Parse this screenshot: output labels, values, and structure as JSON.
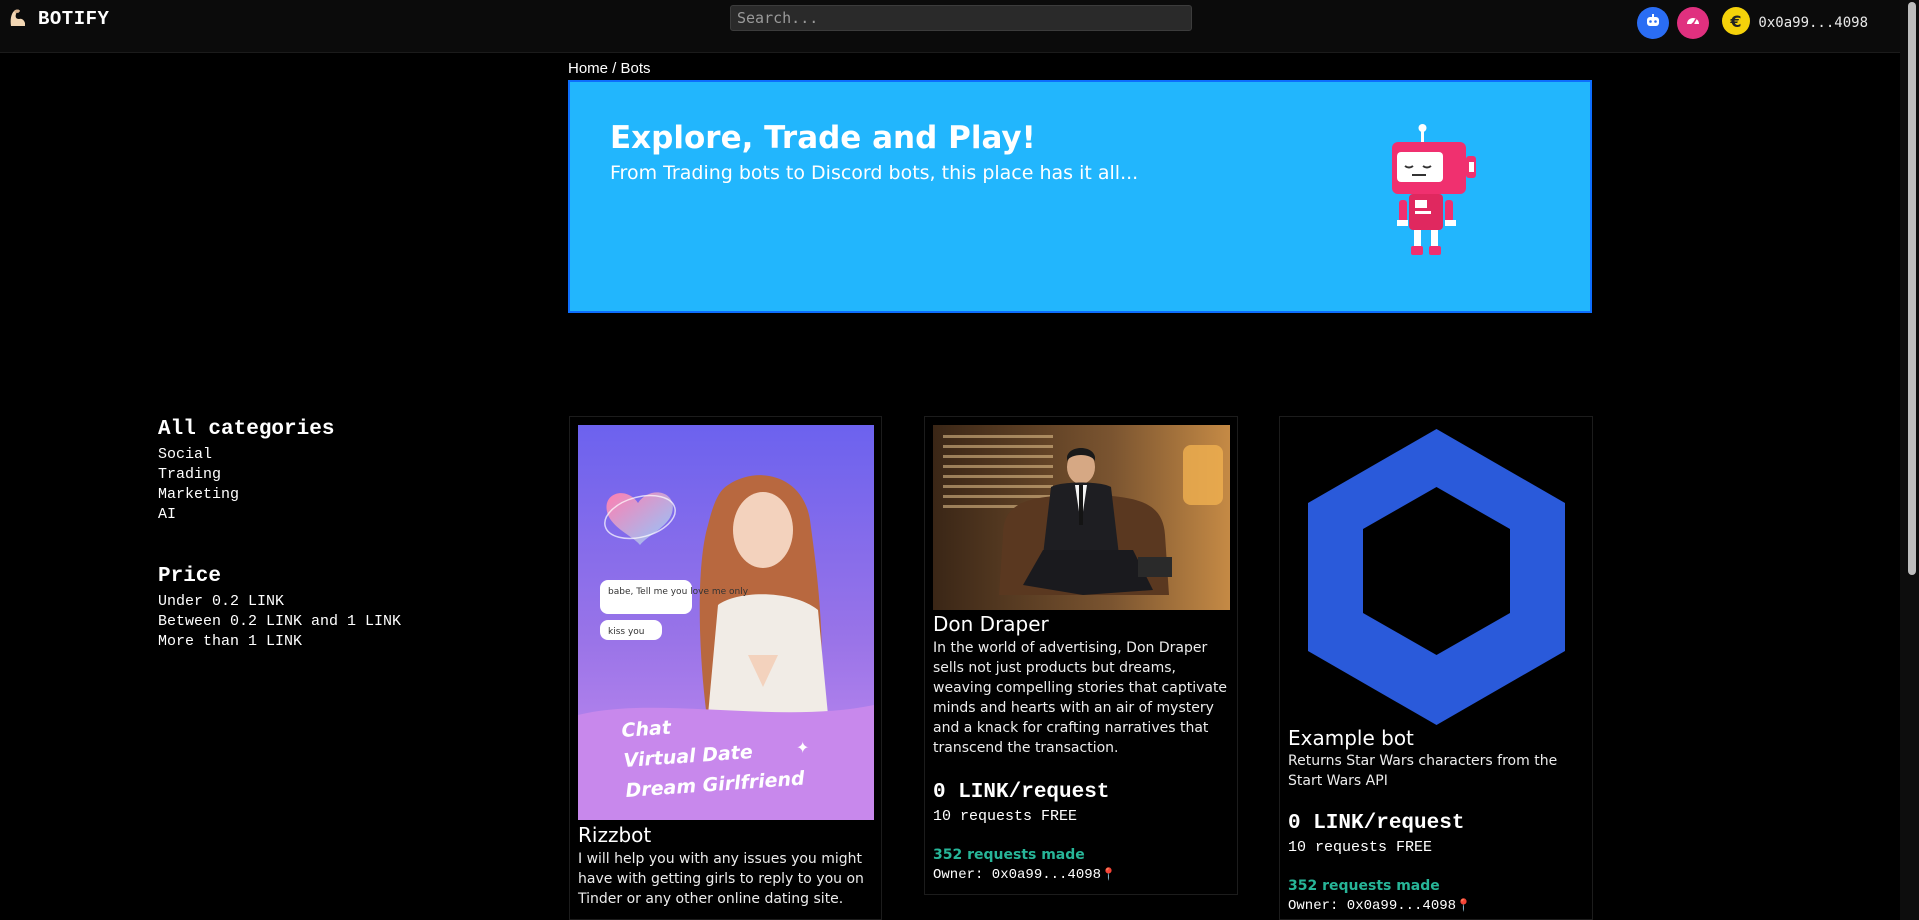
{
  "header": {
    "brand": "BOTIFY",
    "search_placeholder": "Search...",
    "wallet_address": "0x0a99...4098",
    "colors": {
      "bots_button": "#2a6df4",
      "dashboard_button": "#e0307f",
      "wallet_coin": "#f5d20a"
    }
  },
  "breadcrumb": "Home / Bots",
  "banner": {
    "title": "Explore, Trade and Play!",
    "subtitle": "From Trading bots to Discord bots, this place has it all...",
    "background": "#22b6fd"
  },
  "filters": {
    "categories_title": "All categories",
    "categories": [
      "Social",
      "Trading",
      "Marketing",
      "AI"
    ],
    "price_title": "Price",
    "prices": [
      "Under 0.2 LINK",
      "Between 0.2 LINK and 1 LINK",
      "More than 1 LINK"
    ]
  },
  "bots": [
    {
      "name": "Rizzbot",
      "description": "I will help you with any issues you might have with getting girls to reply to you on Tinder or any other online dating site.",
      "image_text": {
        "bubble1": "babe, Tell me you love me only",
        "bubble2": "kiss you",
        "line1": "Chat",
        "line2": "Virtual Date",
        "line3": "Dream Girlfriend"
      }
    },
    {
      "name": "Don Draper",
      "description": "In the world of advertising, Don Draper sells not just products but dreams, weaving compelling stories that captivate minds and hearts with an air of mystery and a knack for crafting narratives that transcend the transaction.",
      "price": "0 LINK/request",
      "free": "10 requests FREE",
      "requests_made": "352 requests made",
      "owner": "Owner: 0x0a99...4098"
    },
    {
      "name": "Example bot",
      "description": "Returns Star Wars characters from the Start Wars API",
      "price": "0 LINK/request",
      "free": "10 requests FREE",
      "requests_made": "352 requests made",
      "owner": "Owner: 0x0a99...4098",
      "logo_color": "#2a5ada"
    }
  ]
}
